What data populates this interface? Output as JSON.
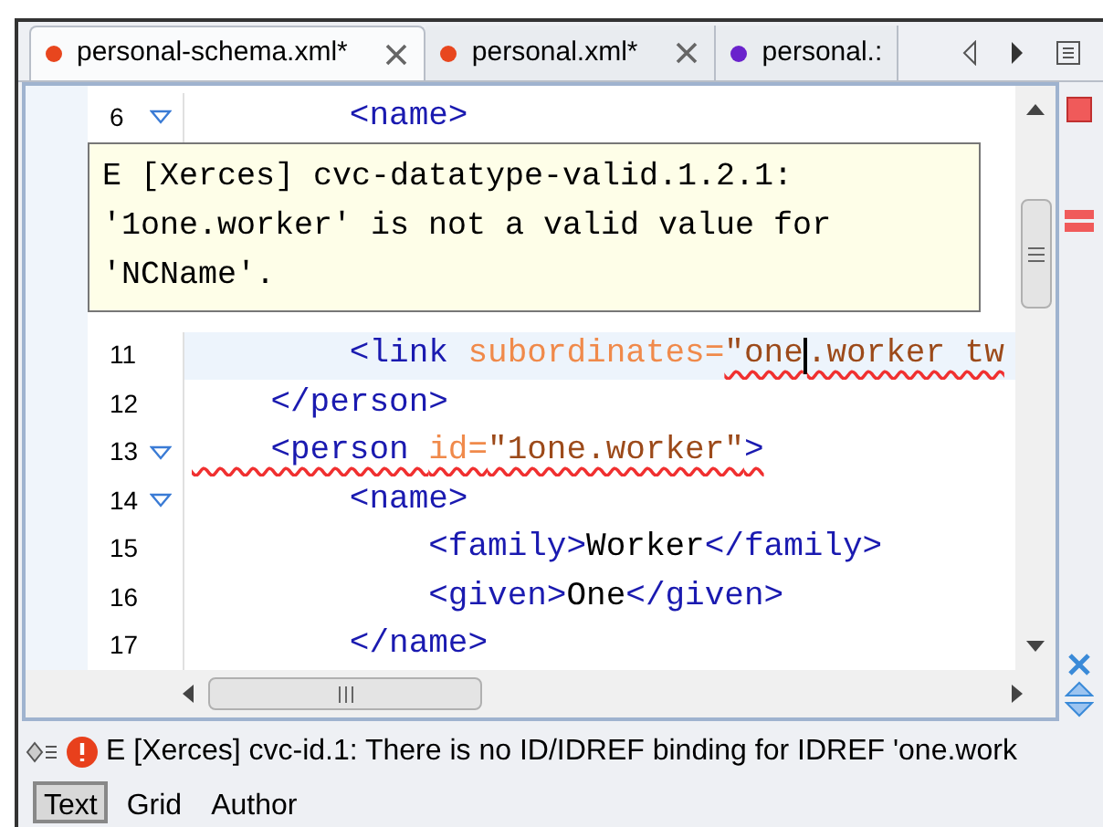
{
  "tabs": [
    {
      "label": "personal-schema.xml*",
      "selected": true,
      "color": "#e8461e",
      "closable": true
    },
    {
      "label": "personal.xml*",
      "selected": false,
      "color": "#e8461e",
      "closable": true
    },
    {
      "label": "personal.:",
      "selected": false,
      "color": "#6a22cc",
      "closable": false
    }
  ],
  "editor": {
    "lines": [
      {
        "number": "6",
        "foldable": true,
        "current": false,
        "tokens": [
          {
            "kind": "tag",
            "text": "        <name>",
            "error": false,
            "caret": false
          }
        ]
      },
      {
        "number": "11",
        "foldable": false,
        "current": true,
        "tokens": [
          {
            "kind": "tag",
            "text": "        <link ",
            "error": false,
            "caret": false
          },
          {
            "kind": "attr",
            "text": "subordinates=",
            "error": false,
            "caret": false
          },
          {
            "kind": "value",
            "text": "\"one",
            "error": true,
            "caret": true
          },
          {
            "kind": "value",
            "text": ".worker tw",
            "error": true,
            "caret": false
          }
        ]
      },
      {
        "number": "12",
        "foldable": false,
        "current": false,
        "tokens": [
          {
            "kind": "tag",
            "text": "    </person>",
            "error": false,
            "caret": false
          }
        ]
      },
      {
        "number": "13",
        "foldable": true,
        "current": false,
        "tokens": [
          {
            "kind": "tag",
            "text": "    <person ",
            "error": true,
            "caret": false
          },
          {
            "kind": "attr",
            "text": "id=",
            "error": true,
            "caret": false
          },
          {
            "kind": "value",
            "text": "\"1one.worker\"",
            "error": true,
            "caret": false
          },
          {
            "kind": "tag",
            "text": ">",
            "error": true,
            "caret": false
          }
        ]
      },
      {
        "number": "14",
        "foldable": true,
        "current": false,
        "tokens": [
          {
            "kind": "tag",
            "text": "        <name>",
            "error": false,
            "caret": false
          }
        ]
      },
      {
        "number": "15",
        "foldable": false,
        "current": false,
        "tokens": [
          {
            "kind": "tag",
            "text": "            <family>",
            "error": false,
            "caret": false
          },
          {
            "kind": "text",
            "text": "Worker",
            "error": false,
            "caret": false
          },
          {
            "kind": "tag",
            "text": "</family>",
            "error": false,
            "caret": false
          }
        ]
      },
      {
        "number": "16",
        "foldable": false,
        "current": false,
        "tokens": [
          {
            "kind": "tag",
            "text": "            <given>",
            "error": false,
            "caret": false
          },
          {
            "kind": "text",
            "text": "One",
            "error": false,
            "caret": false
          },
          {
            "kind": "tag",
            "text": "</given>",
            "error": false,
            "caret": false
          }
        ]
      },
      {
        "number": "17",
        "foldable": false,
        "current": false,
        "tokens": [
          {
            "kind": "tag",
            "text": "        </name>",
            "error": false,
            "caret": false
          }
        ]
      }
    ],
    "tooltip": [
      "E [Xerces] cvc-datatype-valid.1.2.1:",
      "'1one.worker' is not a valid value for",
      "'NCName'."
    ]
  },
  "status_message": "E [Xerces] cvc-id.1: There is no ID/IDREF binding for IDREF 'one.work",
  "modes": [
    {
      "label": "Text",
      "selected": true
    },
    {
      "label": "Grid",
      "selected": false
    },
    {
      "label": "Author",
      "selected": false
    }
  ]
}
